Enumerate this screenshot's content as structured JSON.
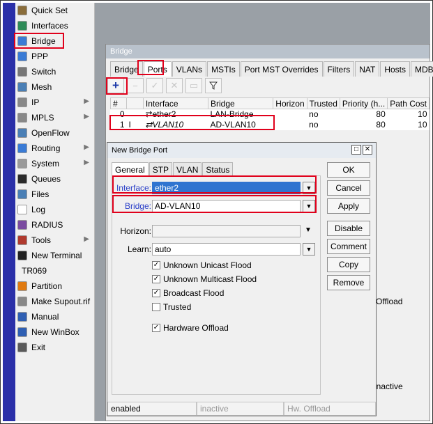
{
  "sidebar": {
    "items": [
      {
        "label": "Quick Set",
        "icon": "quick-set-icon",
        "color": "#8a6d3b",
        "arrow": false
      },
      {
        "label": "Interfaces",
        "icon": "interfaces-icon",
        "color": "#2e8b57",
        "arrow": false
      },
      {
        "label": "Bridge",
        "icon": "bridge-icon",
        "color": "#3a7bd5",
        "arrow": false
      },
      {
        "label": "PPP",
        "icon": "ppp-icon",
        "color": "#3a7bd5",
        "arrow": false
      },
      {
        "label": "Switch",
        "icon": "switch-icon",
        "color": "#777777",
        "arrow": false
      },
      {
        "label": "Mesh",
        "icon": "mesh-icon",
        "color": "#4a7fb5",
        "arrow": false
      },
      {
        "label": "IP",
        "icon": "ip-icon",
        "color": "#888888",
        "arrow": true
      },
      {
        "label": "MPLS",
        "icon": "mpls-icon",
        "color": "#888888",
        "arrow": true
      },
      {
        "label": "OpenFlow",
        "icon": "openflow-icon",
        "color": "#4a7fb5",
        "arrow": false
      },
      {
        "label": "Routing",
        "icon": "routing-icon",
        "color": "#3a7bd5",
        "arrow": true
      },
      {
        "label": "System",
        "icon": "system-icon",
        "color": "#999999",
        "arrow": true
      },
      {
        "label": "Queues",
        "icon": "queues-icon",
        "color": "#2a2a2a",
        "arrow": false
      },
      {
        "label": "Files",
        "icon": "files-icon",
        "color": "#4a7fb5",
        "arrow": false
      },
      {
        "label": "Log",
        "icon": "log-icon",
        "color": "#ffffff",
        "arrow": false
      },
      {
        "label": "RADIUS",
        "icon": "radius-icon",
        "color": "#7a4ba0",
        "arrow": false
      },
      {
        "label": "Tools",
        "icon": "tools-icon",
        "color": "#b03a2e",
        "arrow": true
      },
      {
        "label": "New Terminal",
        "icon": "terminal-icon",
        "color": "#222222",
        "arrow": false
      },
      {
        "label": "TR069",
        "icon": "",
        "color": "",
        "arrow": false
      },
      {
        "label": "Partition",
        "icon": "partition-icon",
        "color": "#e07a10",
        "arrow": false
      },
      {
        "label": "Make Supout.rif",
        "icon": "supout-icon",
        "color": "#888888",
        "arrow": false
      },
      {
        "label": "Manual",
        "icon": "manual-icon",
        "color": "#2f5fb3",
        "arrow": false
      },
      {
        "label": "New WinBox",
        "icon": "winbox-icon",
        "color": "#2f5fb3",
        "arrow": false
      },
      {
        "label": "Exit",
        "icon": "exit-icon",
        "color": "#5a5a5a",
        "arrow": false
      }
    ]
  },
  "bridge_window": {
    "title": "Bridge",
    "tabs": [
      "Bridge",
      "Ports",
      "VLANs",
      "MSTIs",
      "Port MST Overrides",
      "Filters",
      "NAT",
      "Hosts",
      "MDB"
    ],
    "active_tab": "Ports",
    "toolbar": {
      "add": "+",
      "remove": "−",
      "enable": "✓",
      "disable": "✕",
      "comment": "▭",
      "filter": "filter-icon"
    },
    "columns": [
      "#",
      "",
      "Interface",
      "Bridge",
      "Horizon",
      "Trusted",
      "Priority (h...",
      "Path Cost"
    ],
    "rows": [
      {
        "num": "0",
        "flag": "",
        "interface": "ether2",
        "bridge": "LAN-Bridge",
        "horizon": "",
        "trusted": "no",
        "priority": "80",
        "path_cost": "10"
      },
      {
        "num": "1",
        "flag": "I",
        "interface": "VLAN10",
        "bridge": "AD-VLAN10",
        "horizon": "",
        "trusted": "no",
        "priority": "80",
        "path_cost": "10"
      }
    ],
    "behind_text": {
      "offload": "Offload",
      "inactive": "inactive"
    }
  },
  "dialog": {
    "title": "New Bridge Port",
    "tabs": [
      "General",
      "STP",
      "VLAN",
      "Status"
    ],
    "active_tab": "General",
    "fields": {
      "interface_label": "Interface:",
      "interface_value": "ether2",
      "bridge_label": "Bridge:",
      "bridge_value": "AD-VLAN10",
      "horizon_label": "Horizon:",
      "horizon_value": "",
      "learn_label": "Learn:",
      "learn_value": "auto"
    },
    "checkboxes": {
      "unknown_unicast": {
        "label": "Unknown Unicast Flood",
        "checked": true
      },
      "unknown_multicast": {
        "label": "Unknown Multicast Flood",
        "checked": true
      },
      "broadcast": {
        "label": "Broadcast Flood",
        "checked": true
      },
      "trusted": {
        "label": "Trusted",
        "checked": false
      },
      "hw_offload": {
        "label": "Hardware Offload",
        "checked": true
      }
    },
    "buttons": {
      "ok": "OK",
      "cancel": "Cancel",
      "apply": "Apply",
      "disable": "Disable",
      "comment": "Comment",
      "copy": "Copy",
      "remove": "Remove"
    },
    "status": {
      "enabled": "enabled",
      "inactive": "inactive",
      "hw_offload": "Hw. Offload"
    }
  },
  "colors": {
    "highlight": "#e0001b",
    "selection": "#2f74d0",
    "field_label_blue": "#2a3fc8"
  }
}
